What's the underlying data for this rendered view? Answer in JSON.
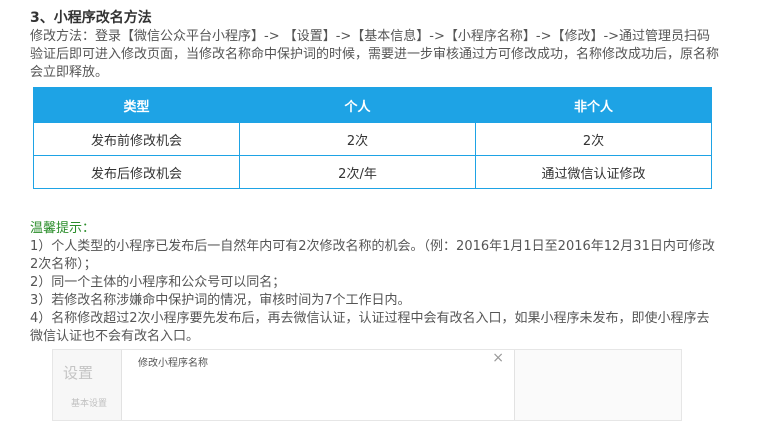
{
  "section_title": "3、小程序改名方法",
  "method_text": "修改方法：登录【微信公众平台小程序】-> 【设置】->【基本信息】->【小程序名称】->【修改】->通过管理员扫码验证后即可进入修改页面，当修改名称命中保护词的时候，需要进一步审核通过方可修改成功，名称修改成功后，原名称会立即释放。",
  "table": {
    "headers": [
      "类型",
      "个人",
      "非个人"
    ],
    "rows": [
      [
        "发布前修改机会",
        "2次",
        "2次"
      ],
      [
        "发布后修改机会",
        "2次/年",
        "通过微信认证修改"
      ]
    ]
  },
  "tips": {
    "title": "温馨提示：",
    "items": [
      "1）个人类型的小程序已发布后一自然年内可有2次修改名称的机会。（例：2016年1月1日至2016年12月31日内可修改2次名称）；",
      "2）同一个主体的小程序和公众号可以同名；",
      "3）若修改名称涉嫌命中保护词的情况，审核时间为7个工作日内。",
      "4）名称修改超过2次小程序要先发布后，再去微信认证，认证过程中会有改名入口，如果小程序未发布，即使小程序去微信认证也不会有改名入口。"
    ]
  },
  "screenshot": {
    "sidebar_title": "设置",
    "sidebar_item": "基本设置",
    "dialog_title": "修改小程序名称",
    "close_glyph": "×"
  },
  "colors": {
    "table_header": "#1ea3e5",
    "tips_title": "#2a8d2a"
  }
}
